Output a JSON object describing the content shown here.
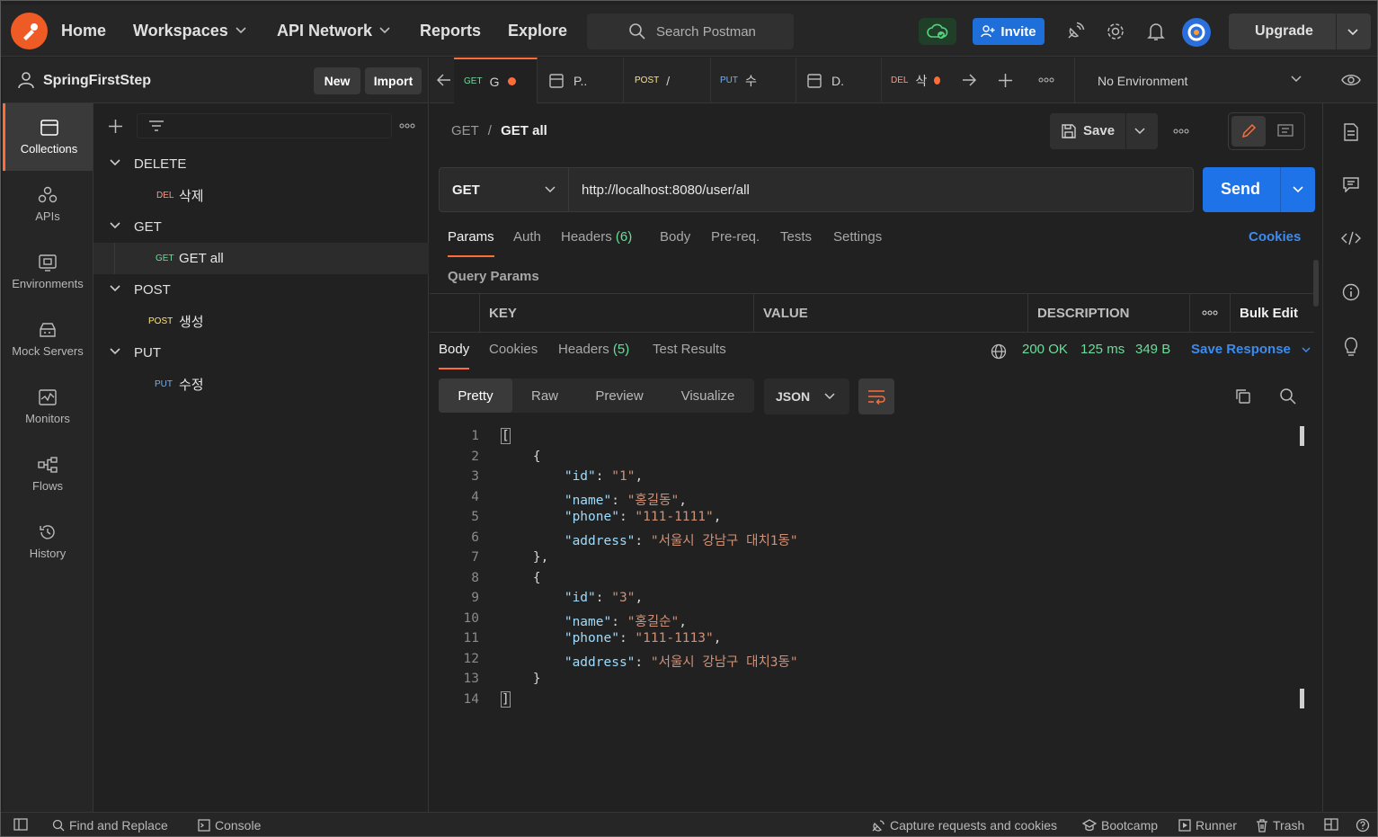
{
  "topbar": {
    "nav": [
      {
        "label": "Home",
        "dropdown": false
      },
      {
        "label": "Workspaces",
        "dropdown": true
      },
      {
        "label": "API Network",
        "dropdown": true
      },
      {
        "label": "Reports",
        "dropdown": false
      },
      {
        "label": "Explore",
        "dropdown": false
      }
    ],
    "search_placeholder": "Search Postman",
    "invite_label": "Invite",
    "upgrade_label": "Upgrade",
    "icons": [
      "cloud-sync-icon",
      "satellite-icon",
      "settings-gear-icon",
      "bell-icon",
      "avatar-icon"
    ]
  },
  "workspace": {
    "name": "SpringFirstStep",
    "new_label": "New",
    "import_label": "Import"
  },
  "rail": [
    {
      "label": "Collections",
      "icon": "collections-icon",
      "active": true
    },
    {
      "label": "APIs",
      "icon": "apis-icon",
      "active": false
    },
    {
      "label": "Environments",
      "icon": "environments-icon",
      "active": false
    },
    {
      "label": "Mock Servers",
      "icon": "mock-servers-icon",
      "active": false
    },
    {
      "label": "Monitors",
      "icon": "monitors-icon",
      "active": false
    },
    {
      "label": "Flows",
      "icon": "flows-icon",
      "active": false
    },
    {
      "label": "History",
      "icon": "history-icon",
      "active": false
    }
  ],
  "tree": [
    {
      "folder": "DELETE",
      "requests": [
        {
          "method": "DEL",
          "label": "삭제",
          "active": false
        }
      ]
    },
    {
      "folder": "GET",
      "requests": [
        {
          "method": "GET",
          "label": "GET all",
          "active": true
        }
      ]
    },
    {
      "folder": "POST",
      "requests": [
        {
          "method": "POST",
          "label": "생성",
          "active": false
        }
      ]
    },
    {
      "folder": "PUT",
      "requests": [
        {
          "method": "PUT",
          "label": "수정",
          "active": false
        }
      ]
    }
  ],
  "tabs": [
    {
      "method": "GET",
      "label": "G",
      "unsaved": true,
      "active": true
    },
    {
      "method": "",
      "label": "P..",
      "unsaved": false,
      "active": false
    },
    {
      "method": "POST",
      "label": "/",
      "unsaved": false,
      "active": false
    },
    {
      "method": "PUT",
      "label": "수",
      "unsaved": false,
      "active": false
    },
    {
      "method": "",
      "label": "D.",
      "unsaved": false,
      "active": false
    },
    {
      "method": "DEL",
      "label": "삭",
      "unsaved": true,
      "active": false
    }
  ],
  "environment": "No Environment",
  "request": {
    "breadcrumb_parent": "GET",
    "breadcrumb_sep": "/",
    "breadcrumb_current": "GET all",
    "save_label": "Save",
    "method": "GET",
    "url": "http://localhost:8080/user/all",
    "send_label": "Send",
    "tabs": [
      {
        "label": "Params",
        "count": "",
        "active": true
      },
      {
        "label": "Auth",
        "count": "",
        "active": false
      },
      {
        "label": "Headers",
        "count": "(6)",
        "active": false
      },
      {
        "label": "Body",
        "count": "",
        "active": false
      },
      {
        "label": "Pre-req.",
        "count": "",
        "active": false
      },
      {
        "label": "Tests",
        "count": "",
        "active": false
      },
      {
        "label": "Settings",
        "count": "",
        "active": false
      }
    ],
    "cookies_label": "Cookies",
    "query_params_title": "Query Params",
    "columns": [
      "KEY",
      "VALUE",
      "DESCRIPTION"
    ],
    "bulk_edit_label": "Bulk Edit"
  },
  "response": {
    "tabs": [
      {
        "label": "Body",
        "count": "",
        "active": true
      },
      {
        "label": "Cookies",
        "count": "",
        "active": false
      },
      {
        "label": "Headers",
        "count": "(5)",
        "active": false
      },
      {
        "label": "Test Results",
        "count": "",
        "active": false
      }
    ],
    "status": "200 OK",
    "time": "125 ms",
    "size": "349 B",
    "save_response_label": "Save Response",
    "views": [
      "Pretty",
      "Raw",
      "Preview",
      "Visualize"
    ],
    "format": "JSON",
    "lines": [
      [
        {
          "t": "[",
          "c": "bk"
        }
      ],
      [
        {
          "t": "    {",
          "c": ""
        }
      ],
      [
        {
          "t": "        ",
          "c": ""
        },
        {
          "t": "\"id\"",
          "c": "k"
        },
        {
          "t": ": ",
          "c": ""
        },
        {
          "t": "\"1\"",
          "c": "s"
        },
        {
          "t": ",",
          "c": ""
        }
      ],
      [
        {
          "t": "        ",
          "c": ""
        },
        {
          "t": "\"name\"",
          "c": "k"
        },
        {
          "t": ": ",
          "c": ""
        },
        {
          "t": "\"홍길동\"",
          "c": "s"
        },
        {
          "t": ",",
          "c": ""
        }
      ],
      [
        {
          "t": "        ",
          "c": ""
        },
        {
          "t": "\"phone\"",
          "c": "k"
        },
        {
          "t": ": ",
          "c": ""
        },
        {
          "t": "\"111-1111\"",
          "c": "s"
        },
        {
          "t": ",",
          "c": ""
        }
      ],
      [
        {
          "t": "        ",
          "c": ""
        },
        {
          "t": "\"address\"",
          "c": "k"
        },
        {
          "t": ": ",
          "c": ""
        },
        {
          "t": "\"서울시 강남구 대치1동\"",
          "c": "s"
        }
      ],
      [
        {
          "t": "    },",
          "c": ""
        }
      ],
      [
        {
          "t": "    {",
          "c": ""
        }
      ],
      [
        {
          "t": "        ",
          "c": ""
        },
        {
          "t": "\"id\"",
          "c": "k"
        },
        {
          "t": ": ",
          "c": ""
        },
        {
          "t": "\"3\"",
          "c": "s"
        },
        {
          "t": ",",
          "c": ""
        }
      ],
      [
        {
          "t": "        ",
          "c": ""
        },
        {
          "t": "\"name\"",
          "c": "k"
        },
        {
          "t": ": ",
          "c": ""
        },
        {
          "t": "\"홍길순\"",
          "c": "s"
        },
        {
          "t": ",",
          "c": ""
        }
      ],
      [
        {
          "t": "        ",
          "c": ""
        },
        {
          "t": "\"phone\"",
          "c": "k"
        },
        {
          "t": ": ",
          "c": ""
        },
        {
          "t": "\"111-1113\"",
          "c": "s"
        },
        {
          "t": ",",
          "c": ""
        }
      ],
      [
        {
          "t": "        ",
          "c": ""
        },
        {
          "t": "\"address\"",
          "c": "k"
        },
        {
          "t": ": ",
          "c": ""
        },
        {
          "t": "\"서울시 강남구 대치3동\"",
          "c": "s"
        }
      ],
      [
        {
          "t": "    }",
          "c": ""
        }
      ],
      [
        {
          "t": "]",
          "c": "bk"
        }
      ]
    ]
  },
  "right_rail_icons": [
    "documentation-icon",
    "comments-icon",
    "code-icon",
    "info-icon",
    "lightbulb-icon"
  ],
  "footer": {
    "left": [
      {
        "label": "",
        "icon": "sidebar-toggle-icon"
      },
      {
        "label": "Find and Replace",
        "icon": "search-icon"
      },
      {
        "label": "Console",
        "icon": "console-icon"
      }
    ],
    "right": [
      {
        "label": "Capture requests and cookies",
        "icon": "capture-icon"
      },
      {
        "label": "Bootcamp",
        "icon": "bootcamp-icon"
      },
      {
        "label": "Runner",
        "icon": "runner-icon"
      },
      {
        "label": "Trash",
        "icon": "trash-icon"
      },
      {
        "label": "",
        "icon": "two-pane-icon"
      },
      {
        "label": "",
        "icon": "help-icon"
      }
    ]
  },
  "colors": {
    "accent": "#ff6c37",
    "send": "#1e73e8",
    "get": "#6bdd9a",
    "post": "#ffe47e",
    "put": "#74aef6",
    "del": "#f79a8e",
    "status_ok": "#6bdd9a",
    "link": "#3c8cf0"
  }
}
